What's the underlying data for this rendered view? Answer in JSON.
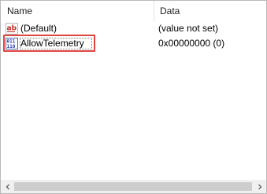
{
  "columns": {
    "name": "Name",
    "data": "Data"
  },
  "rows": [
    {
      "icon": "string-value-icon",
      "name": "(Default)",
      "data": "(value not set)"
    },
    {
      "icon": "dword-value-icon",
      "name": "AllowTelemetry",
      "data": "0x00000000 (0)"
    }
  ],
  "colors": {
    "highlight": "#e0453f",
    "scrollbar_track": "#f0f0f0",
    "scrollbar_thumb": "#cdcdcd"
  }
}
